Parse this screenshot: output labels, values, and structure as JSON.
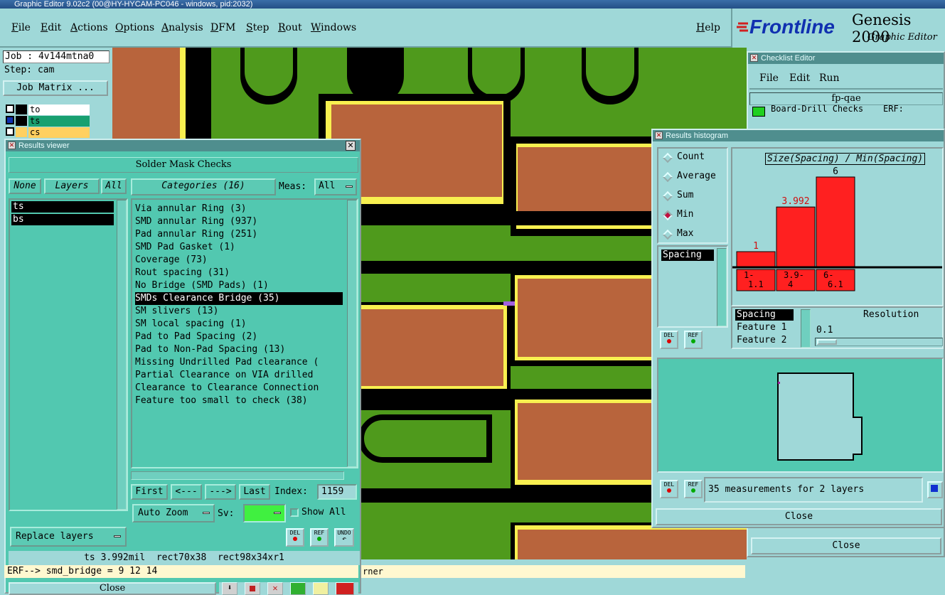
{
  "window": {
    "title": "Graphic Editor 9.02c2 (00@HY-HYCAM-PC046 - windows, pid:2032)"
  },
  "menu": {
    "items": [
      "File",
      "Edit",
      "Actions",
      "Options",
      "Analysis",
      "DFM",
      "Step",
      "Rout",
      "Windows"
    ],
    "help": "Help"
  },
  "brand": {
    "logo": "Frontline",
    "product": "Genesis 2000",
    "subtitle": "Graphic Editor"
  },
  "job": {
    "job_label": "Job : 4v144mtna0",
    "step_label": "Step: cam",
    "matrix_button": "Job Matrix ..."
  },
  "layers_panel": {
    "rows": [
      {
        "name": "to",
        "color": "#ffffff"
      },
      {
        "name": "ts",
        "color": "#18a070"
      },
      {
        "name": "cs",
        "color": "#ffd060"
      }
    ]
  },
  "results_viewer": {
    "title": "Results viewer",
    "header": "Solder Mask Checks",
    "none_btn": "None",
    "layers_btn": "Layers",
    "all_btn": "All",
    "layers": [
      "ts",
      "bs"
    ],
    "categories_btn": "Categories (16)",
    "meas_label": "Meas:",
    "meas_value": "All",
    "categories": [
      "Via annular Ring (3)",
      "SMD annular Ring (937)",
      "Pad annular Ring (251)",
      "SMD Pad Gasket (1)",
      "Coverage (73)",
      "Rout spacing (31)",
      "No Bridge (SMD Pads) (1)",
      "SMDs Clearance Bridge (35)",
      "SM slivers (13)",
      "SM local spacing (1)",
      "Pad to Pad Spacing (2)",
      "Pad to Non-Pad Spacing (13)",
      "Missing Undrilled Pad clearance (",
      "Partial Clearance on VIA drilled",
      "Clearance to Clearance Connection",
      "Feature too small to check (38)"
    ],
    "selected_index": 7,
    "nav": {
      "first": "First",
      "prev": "<---",
      "next": "--->",
      "last": "Last",
      "index_label": "Index:",
      "index_value": "1159"
    },
    "auto_zoom": "Auto Zoom",
    "sv_label": "Sv:",
    "show_all": "Show All",
    "replace_layers": "Replace layers",
    "icon_labels": {
      "del": "DEL",
      "ref": "REF",
      "undo": "UNDO"
    },
    "info": "ts 3.992mil  rect70x38  rect98x34xr1",
    "close": "Close"
  },
  "status": {
    "erf": "ERF--> smd_bridge = 9 12 14",
    "tail": "rner"
  },
  "checklist_editor": {
    "title": "Checklist Editor",
    "menu": [
      "File",
      "Edit",
      "Run"
    ],
    "name": "fp-qae",
    "row_label": "Board-Drill Checks",
    "erf_label": "ERF:",
    "close": "Close"
  },
  "histogram": {
    "title": "Results histogram",
    "modes": [
      "Count",
      "Average",
      "Sum",
      "Min",
      "Max"
    ],
    "selected_mode": "Min",
    "list_item": "Spacing",
    "chart_title": "Size(Spacing) / Min(Spacing)",
    "sort_items": [
      "Spacing",
      "Feature 1",
      "Feature 2"
    ],
    "resolution_label": "Resolution",
    "resolution_value": "0.1",
    "summary": "35 measurements for 2 layers",
    "close": "Close",
    "bar_color": "#ff2020"
  },
  "chart_data": {
    "type": "bar",
    "title": "Size(Spacing) / Min(Spacing)",
    "categories": [
      "1- 1.1",
      "3.9- 4",
      "6- 6.1"
    ],
    "values": [
      1,
      3.992,
      6
    ],
    "value_labels": [
      "1",
      "3.992",
      "6"
    ],
    "xlabel": "",
    "ylabel": "",
    "ylim": [
      0,
      6
    ]
  }
}
